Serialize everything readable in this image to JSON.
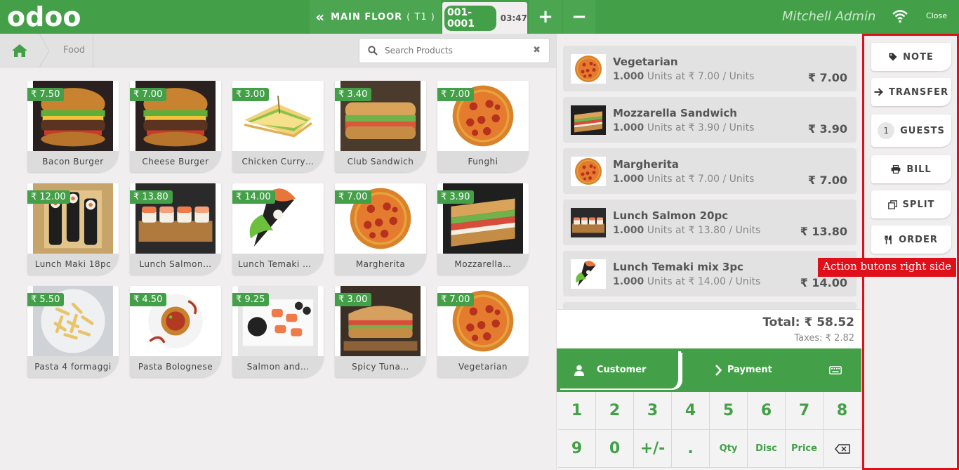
{
  "topbar": {
    "logo": "odoo",
    "floor_label": "MAIN FLOOR",
    "table_label": "( T1 )",
    "order_number": "001-0001",
    "order_time": "03:47",
    "add_order": "+",
    "remove_order": "−",
    "user_name": "Mitchell Admin",
    "close_label": "Close"
  },
  "breadcrumb": {
    "category": "Food"
  },
  "search": {
    "placeholder": "Search Products",
    "clear": "✖"
  },
  "products": [
    {
      "name": "Bacon Burger",
      "price": "₹ 7.50",
      "img": "burger-image"
    },
    {
      "name": "Cheese Burger",
      "price": "₹ 7.00",
      "img": "burger-image"
    },
    {
      "name": "Chicken Curry…",
      "price": "₹ 3.00",
      "img": "sandwich-image"
    },
    {
      "name": "Club Sandwich",
      "price": "₹ 3.40",
      "img": "sub-sandwich-image"
    },
    {
      "name": "Funghi",
      "price": "₹ 7.00",
      "img": "pizza-image"
    },
    {
      "name": "Lunch Maki 18pc",
      "price": "₹ 12.00",
      "img": "maki-image"
    },
    {
      "name": "Lunch Salmon…",
      "price": "₹ 13.80",
      "img": "sushi-image"
    },
    {
      "name": "Lunch Temaki mix…",
      "price": "₹ 14.00",
      "img": "temaki-image"
    },
    {
      "name": "Margherita",
      "price": "₹ 7.00",
      "img": "pizza-image"
    },
    {
      "name": "Mozzarella…",
      "price": "₹ 3.90",
      "img": "mozzarella-sandwich-image"
    },
    {
      "name": "Pasta 4 formaggi",
      "price": "₹ 5.50",
      "img": "pasta-image"
    },
    {
      "name": "Pasta Bolognese",
      "price": "₹ 4.50",
      "img": "bolognese-image"
    },
    {
      "name": "Salmon and…",
      "price": "₹ 9.25",
      "img": "salmon-image"
    },
    {
      "name": "Spicy Tuna…",
      "price": "₹ 3.00",
      "img": "tuna-sandwich-image"
    },
    {
      "name": "Vegetarian",
      "price": "₹ 7.00",
      "img": "pizza-image"
    }
  ],
  "orderlines": [
    {
      "name": "Vegetarian",
      "qty": "1.000",
      "detail": " Units at ₹ 7.00 / Units",
      "total": "₹ 7.00",
      "img": "pizza-image"
    },
    {
      "name": "Mozzarella Sandwich",
      "qty": "1.000",
      "detail": " Units at ₹ 3.90 / Units",
      "total": "₹ 3.90",
      "img": "mozzarella-sandwich-image"
    },
    {
      "name": "Margherita",
      "qty": "1.000",
      "detail": " Units at ₹ 7.00 / Units",
      "total": "₹ 7.00",
      "img": "pizza-image"
    },
    {
      "name": "Lunch Salmon 20pc",
      "qty": "1.000",
      "detail": " Units at ₹ 13.80 / Units",
      "total": "₹ 13.80",
      "img": "sushi-image"
    },
    {
      "name": "Lunch Temaki mix 3pc",
      "qty": "1.000",
      "detail": " Units at ₹ 14.00 / Units",
      "total": "₹ 14.00",
      "img": "temaki-image"
    }
  ],
  "summary": {
    "total": "Total: ₹ 58.52",
    "taxes": "Taxes: ₹ 2.82"
  },
  "actions": {
    "customer": "Customer",
    "payment": "Payment"
  },
  "numpad": [
    "1",
    "2",
    "3",
    "4",
    "5",
    "6",
    "7",
    "8",
    "9",
    "0",
    "+/-",
    ".",
    "Qty",
    "Disc",
    "Price",
    "⌫"
  ],
  "right_buttons": {
    "note": "NOTE",
    "transfer": "TRANSFER",
    "guests_count": "1",
    "guests": "GUESTS",
    "bill": "BILL",
    "split": "SPLIT",
    "order": "ORDER"
  },
  "annotation": "Action butons right side",
  "colors": {
    "brand": "#43a048",
    "annotation": "#e0101a"
  }
}
